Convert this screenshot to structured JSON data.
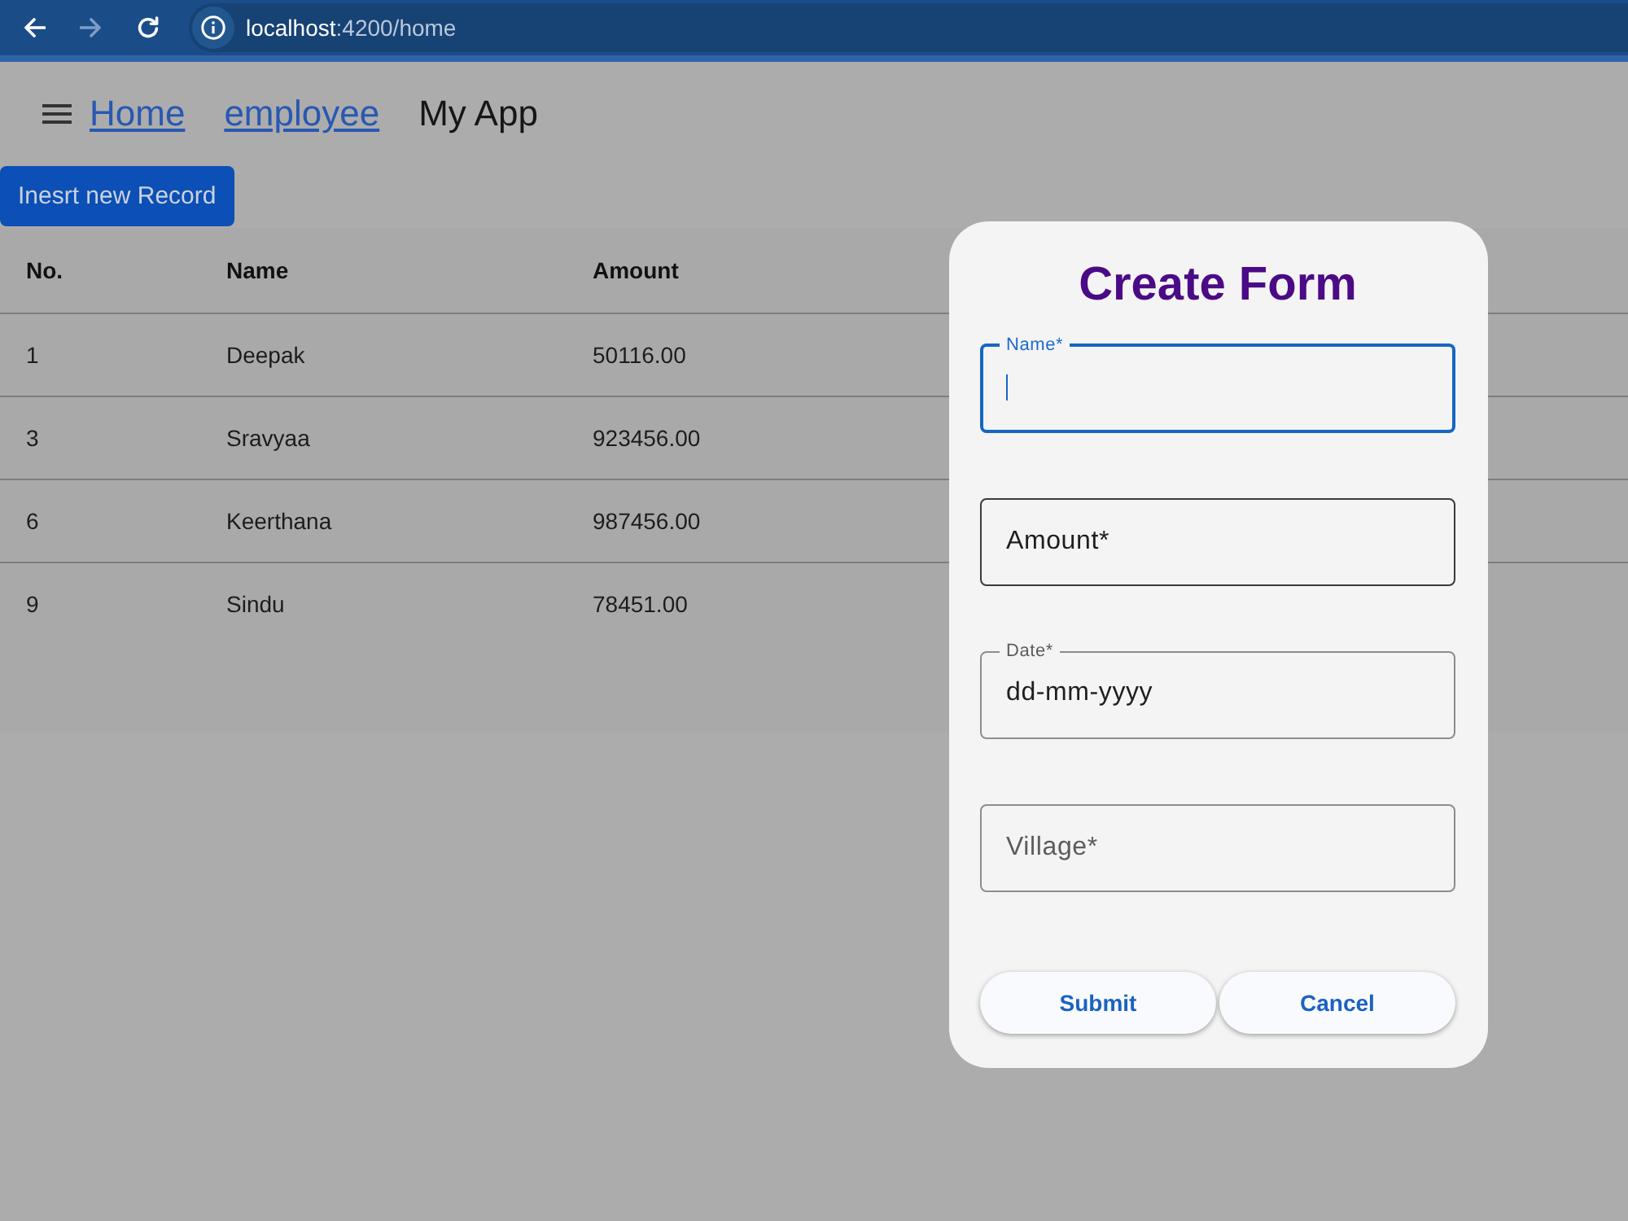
{
  "browser": {
    "nav": [
      {
        "kind": "back",
        "disabled": false
      },
      {
        "kind": "forward",
        "disabled": true
      },
      {
        "kind": "reload",
        "disabled": false
      }
    ],
    "host": "localhost",
    "path": ":4200/home"
  },
  "toolbar": {
    "links": [
      "Home",
      "employee"
    ],
    "title": "My App"
  },
  "insert_button": {
    "label": "Inesrt new Record"
  },
  "table": {
    "columns": [
      "No.",
      "Name",
      "Amount"
    ],
    "rows": [
      [
        "1",
        "Deepak",
        "50116.00"
      ],
      [
        "3",
        "Sravyaa",
        "923456.00"
      ],
      [
        "6",
        "Keerthana",
        "987456.00"
      ],
      [
        "9",
        "Sindu",
        "78451.00"
      ]
    ]
  },
  "dialog": {
    "title": "Create Form",
    "fields": [
      {
        "label": "Name*",
        "focused": true,
        "hovered": false
      },
      {
        "label": "Amount*",
        "focused": false,
        "hovered": true
      },
      {
        "label": "Date*",
        "focused": false,
        "hovered": false,
        "placeholder": "dd-mm-yyyy"
      },
      {
        "label": "Village*",
        "focused": false,
        "hovered": false
      }
    ],
    "buttons": [
      "Submit",
      "Cancel"
    ]
  }
}
